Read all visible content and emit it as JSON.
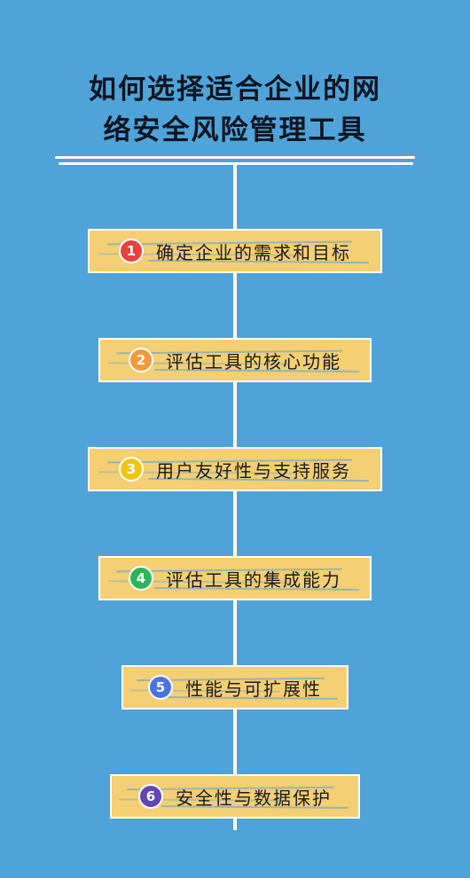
{
  "title": {
    "line1": "如何选择适合企业的网",
    "line2": "络安全风险管理工具"
  },
  "colors": {
    "background": "#4fa3d8",
    "box_fill": "#f5cf73",
    "line": "#ffffff",
    "step_badges": [
      "#e8423f",
      "#f39a3c",
      "#f2c60f",
      "#2eb45a",
      "#4d73e3",
      "#6346b5"
    ]
  },
  "steps": [
    {
      "number": "1",
      "label": "确定企业的需求和目标"
    },
    {
      "number": "2",
      "label": "评估工具的核心功能"
    },
    {
      "number": "3",
      "label": "用户友好性与支持服务"
    },
    {
      "number": "4",
      "label": "评估工具的集成能力"
    },
    {
      "number": "5",
      "label": "性能与可扩展性"
    },
    {
      "number": "6",
      "label": "安全性与数据保护"
    }
  ]
}
